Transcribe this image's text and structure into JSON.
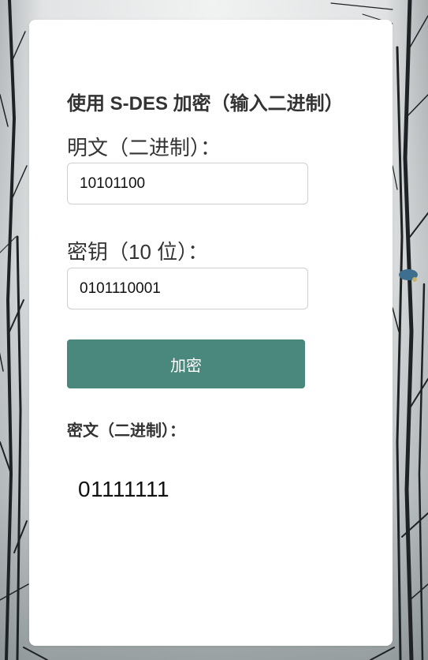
{
  "card": {
    "title": "使用 S-DES 加密（输入二进制）",
    "plaintext_label": "明文（二进制）：",
    "plaintext_value": "10101100",
    "key_label": "密钥（10 位）：",
    "key_value": "0101110001",
    "encrypt_button": "加密",
    "ciphertext_label": "密文（二进制）：",
    "ciphertext_value": "01111111"
  },
  "colors": {
    "accent": "#4a877c",
    "card_background": "#ffffff",
    "text": "#333333"
  }
}
